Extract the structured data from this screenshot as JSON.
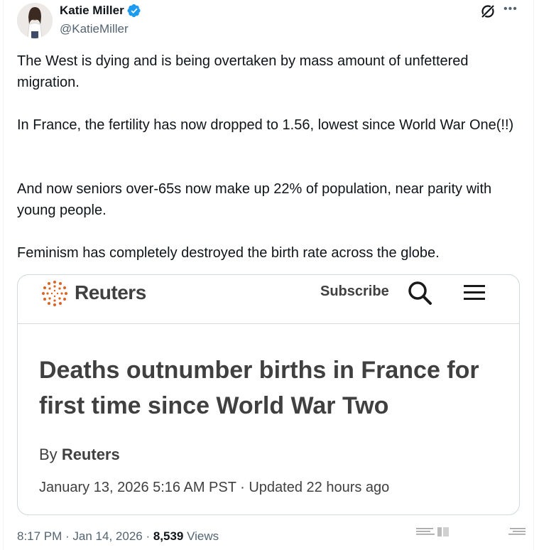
{
  "author": {
    "name": "Katie Miller",
    "handle": "@KatieMiller"
  },
  "tweet": {
    "paragraphs": [
      "The West is dying and is being overtaken by mass amount of unfettered migration.",
      "In France, the fertility has now dropped to 1.56, lowest since World War One(!!)",
      "And now seniors over-65s now make up 22% of population, near parity with young people.",
      "Feminism has completely destroyed the birth rate across the globe."
    ]
  },
  "card": {
    "brand": "Reuters",
    "subscribe_label": "Subscribe",
    "headline": "Deaths outnumber births in France for first time since World War Two",
    "byline_prefix": "By",
    "byline_author": "Reuters",
    "dateline": "January 13, 2026 5:16 AM PST · Updated 22 hours ago"
  },
  "meta": {
    "time": "8:17 PM",
    "separator": " · ",
    "date": "Jan 14, 2026",
    "views_count": "8,539",
    "views_label": "Views"
  },
  "colors": {
    "verified_blue": "#1d9bf0",
    "reuters_orange": "#e2611f",
    "text_primary": "#0f1419",
    "text_secondary": "#536471"
  },
  "icons": [
    "verified-badge-icon",
    "grok-icon",
    "more-icon",
    "reuters-logo-icon",
    "search-icon",
    "menu-icon"
  ]
}
